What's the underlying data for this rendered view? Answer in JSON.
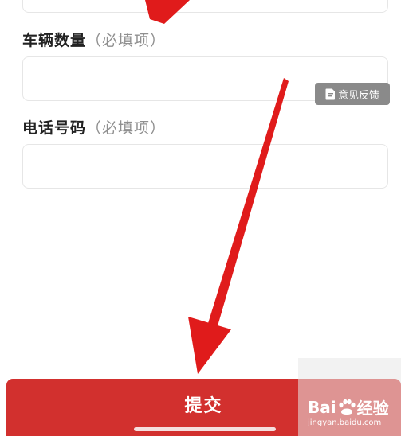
{
  "form": {
    "fields": [
      {
        "label": "车辆数量",
        "hint": "（必填项）",
        "value": "",
        "placeholder": ""
      },
      {
        "label": "电话号码",
        "hint": "（必填项）",
        "value": "",
        "placeholder": ""
      }
    ]
  },
  "feedback": {
    "label": "意见反馈",
    "icon": "document-icon"
  },
  "submit": {
    "label": "提交"
  },
  "watermark": {
    "brand_left": "Bai",
    "brand_right": "经验",
    "sub": "jingyan.baidu.com",
    "icon": "paw-icon"
  },
  "colors": {
    "submit_bg": "#d2302e",
    "arrow": "#e01b1b",
    "feedback_bg": "#8a8a8a",
    "hint": "#8f8f8f"
  }
}
